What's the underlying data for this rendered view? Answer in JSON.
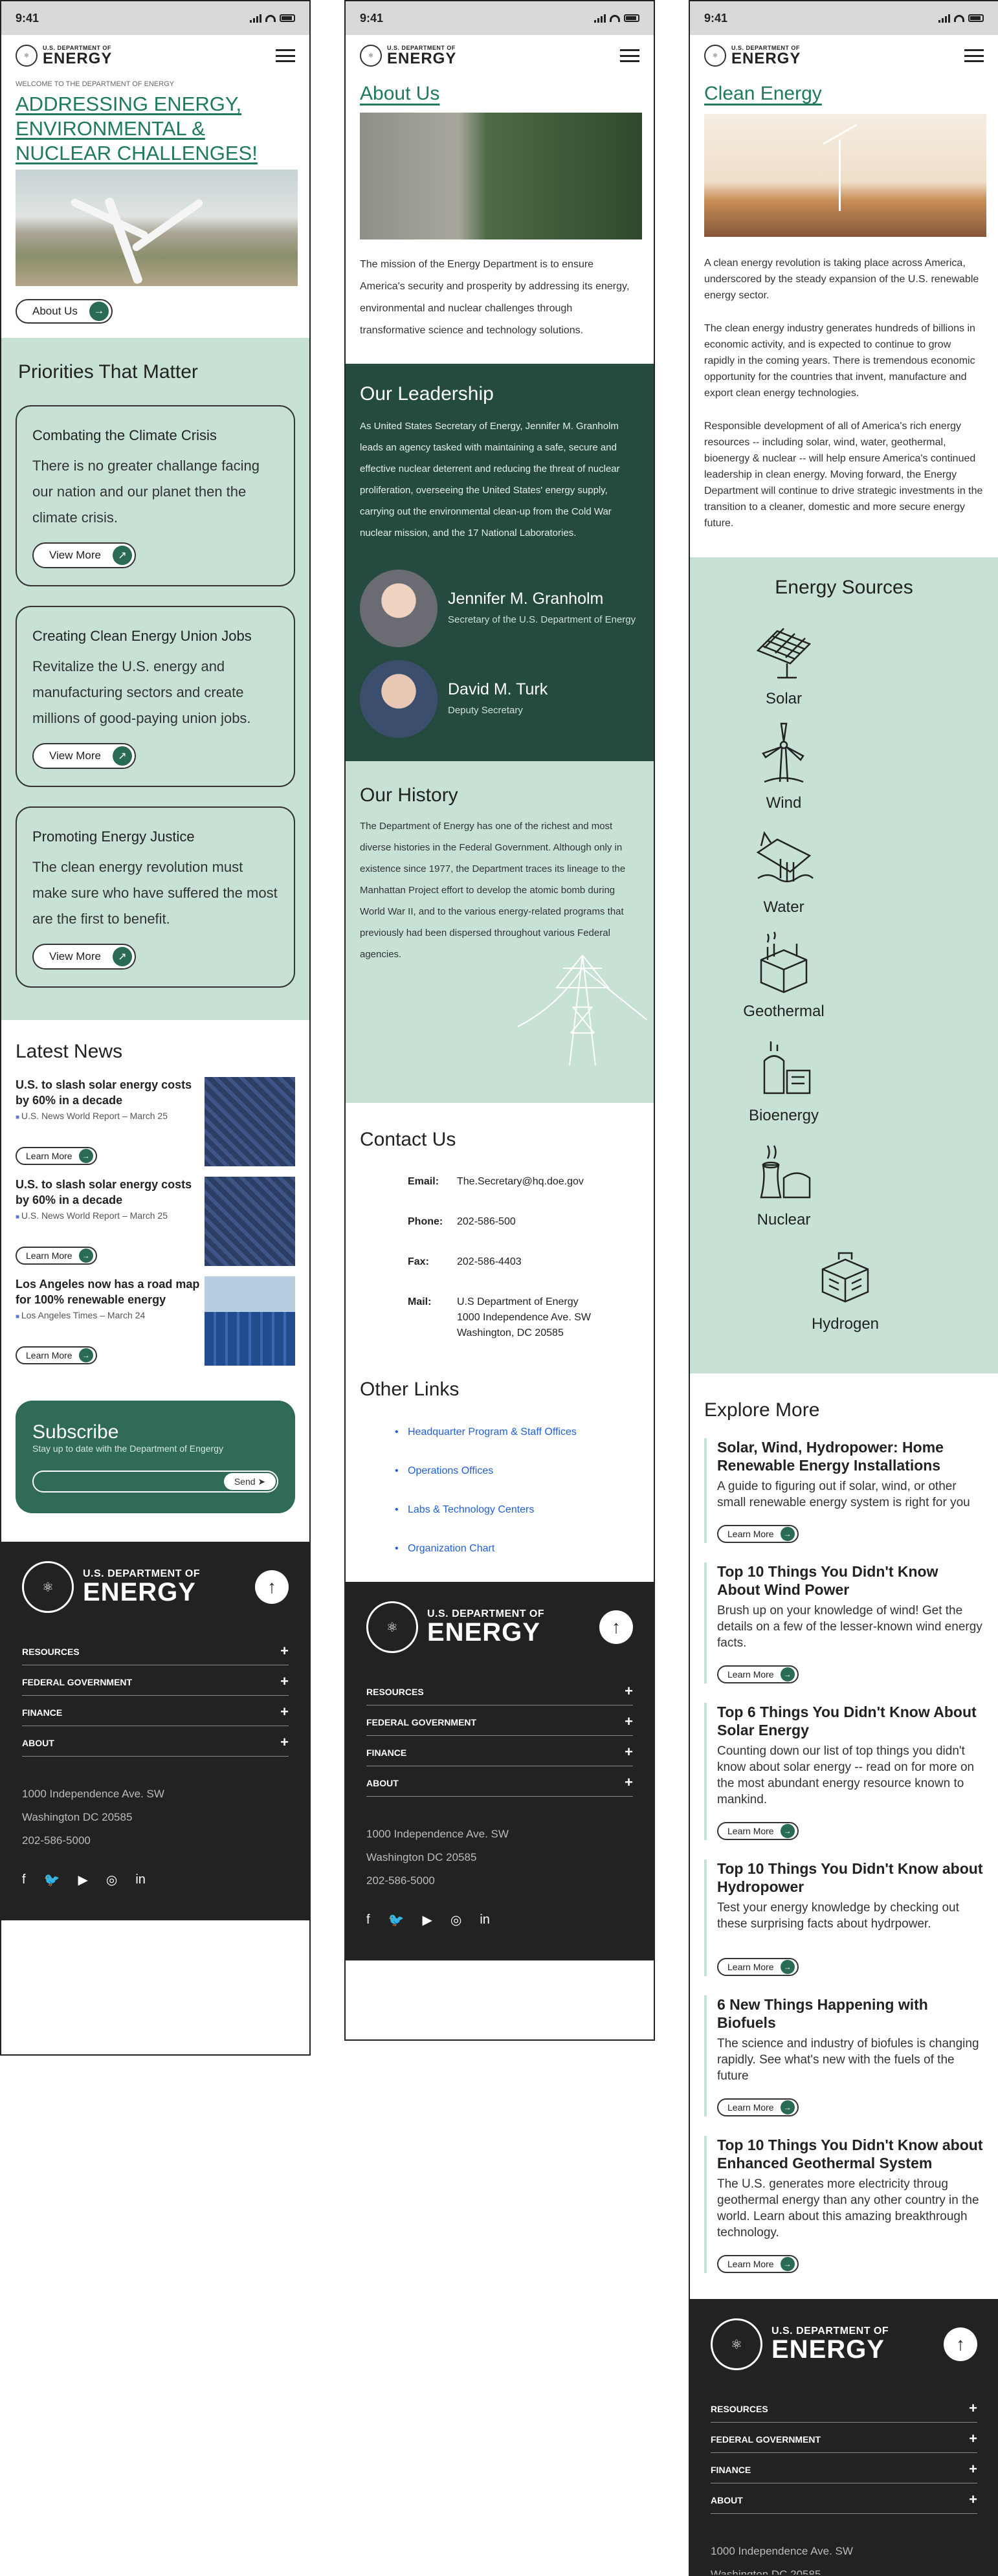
{
  "status": {
    "time": "9:41"
  },
  "brand": {
    "small": "U.S. DEPARTMENT OF",
    "big": "ENERGY"
  },
  "home": {
    "welcome": "WELCOME TO THE DEPARTMENT OF ENERGY",
    "hero": "ADDRESSING ENERGY, ENVIRONMENTAL & NUCLEAR CHALLENGES!",
    "about_btn": "About Us",
    "priorities_title": "Priorities That Matter",
    "cards": [
      {
        "title": "Combating the Climate Crisis",
        "body": "There is no greater challange facing our nation and our planet then the climate crisis.",
        "btn": "View More"
      },
      {
        "title": "Creating Clean Energy Union Jobs",
        "body": "Revitalize the U.S. energy and manufacturing sectors and create millions of good-paying union jobs.",
        "btn": "View More"
      },
      {
        "title": "Promoting Energy Justice",
        "body": "The clean energy revolution must make sure who have suffered the most are the first to benefit.",
        "btn": "View More"
      }
    ],
    "news_title": "Latest News",
    "news": [
      {
        "title": "U.S. to slash solar energy costs by 60% in a decade",
        "source": "U.S. News World Report – March 25",
        "btn": "Learn More"
      },
      {
        "title": "U.S. to slash solar energy costs by 60% in a decade",
        "source": "U.S. News World Report – March 25",
        "btn": "Learn More"
      },
      {
        "title": "Los Angeles now has a road map for 100% renewable energy",
        "source": "Los Angeles Times – March 24",
        "btn": "Learn More"
      }
    ],
    "subscribe": {
      "title": "Subscribe",
      "subtitle": "Stay up to date with the Department of Engergy",
      "send": "Send"
    }
  },
  "footer": {
    "rows": [
      "RESOURCES",
      "FEDERAL GOVERNMENT",
      "FINANCE",
      "ABOUT"
    ],
    "addr1": "1000 Independence Ave. SW",
    "addr2": "Washington DC 20585",
    "phone": "202-586-5000"
  },
  "about": {
    "title": "About Us",
    "mission": "The mission of the Energy Department is to ensure America's security and prosperity by addressing its energy, environmental and nuclear challenges through transformative science and technology solutions.",
    "leadership_title": "Our Leadership",
    "leadership_text": "As United States Secretary of Energy, Jennifer M. Granholm leads an agency tasked with maintaining a safe, secure and effective nuclear deterrent and reducing the threat of nuclear proliferation, overseeing the United States' energy supply, carrying out the environmental clean-up from the Cold War nuclear mission, and the 17 National Laboratories.",
    "leaders": [
      {
        "name": "Jennifer M. Granholm",
        "role": "Secretary of the U.S. Department of Energy"
      },
      {
        "name": "David M. Turk",
        "role": "Deputy Secretary"
      }
    ],
    "history_title": "Our History",
    "history_text": "The Department of Energy has one of the richest and most diverse histories in the Federal Government. Although only in existence since 1977, the Department traces its lineage to the Manhattan Project effort to develop the atomic bomb during World War II, and to the various energy-related programs that previously had been dispersed throughout various Federal agencies.",
    "contact_title": "Contact Us",
    "contact": [
      {
        "label": "Email:",
        "value": "The.Secretary@hq.doe.gov"
      },
      {
        "label": "Phone:",
        "value": "202-586-500"
      },
      {
        "label": "Fax:",
        "value": "202-586-4403"
      },
      {
        "label": "Mail:",
        "value": "U.S Department of Energy 1000 Independence Ave. SW Washington, DC 20585"
      }
    ],
    "links_title": "Other Links",
    "links": [
      "Headquarter Program & Staff Offices",
      "Operations Offices",
      "Labs & Technology Centers",
      "Organization Chart"
    ]
  },
  "clean": {
    "title": "Clean Energy",
    "p1": "A clean energy revolution is taking place across America, underscored by the steady expansion of the U.S. renewable energy sector.",
    "p2": "The clean energy industry generates hundreds of billions in economic activity, and is expected to continue to grow rapidly in the coming years. There is tremendous economic opportunity for the countries that invent, manufacture and export clean energy technologies.",
    "p3": "Responsible development of all of America's rich energy resources -- including solar, wind, water, geothermal, bioenergy & nuclear -- will help ensure America's continued leadership in clean energy. Moving forward, the Energy Department will continue to drive strategic investments in the transition to a cleaner, domestic and more secure energy future.",
    "sources_title": "Energy Sources",
    "sources": [
      "Solar",
      "Wind",
      "Water",
      "Geothermal",
      "Bioenergy",
      "Nuclear",
      "Hydrogen"
    ],
    "explore_title": "Explore More",
    "explore": [
      {
        "title": "Solar, Wind, Hydropower: Home Renewable Energy Installations",
        "body": "A guide to figuring out if solar, wind, or other small renewable energy system is right for you",
        "btn": "Learn More"
      },
      {
        "title": "Top 10 Things You Didn't Know About Wind Power",
        "body": "Brush up on your knowledge of wind! Get the details on a few of the lesser-known wind energy facts.",
        "btn": "Learn More"
      },
      {
        "title": "Top 6 Things You Didn't Know About Solar Energy",
        "body": "Counting down our list of top things you didn't know about solar energy -- read on for more on the most abundant energy resource known  to mankind.",
        "btn": "Learn More"
      },
      {
        "title": "Top 10 Things You Didn't Know about Hydropower",
        "body": "Test your energy knowledge by checking out these surprising facts about hydrpower.",
        "btn": "Learn More"
      },
      {
        "title": "6 New Things Happening with Biofuels",
        "body": "The science and industry of biofules is changing rapidly. See what's new with the fuels of the future",
        "btn": "Learn More"
      },
      {
        "title": "Top 10 Things You Didn't Know about Enhanced Geothermal System",
        "body": "The U.S. generates more electricity throug geothermal energy than any other country in the world. Learn about this amazing breakthrough technology.",
        "btn": "Learn More"
      }
    ]
  }
}
